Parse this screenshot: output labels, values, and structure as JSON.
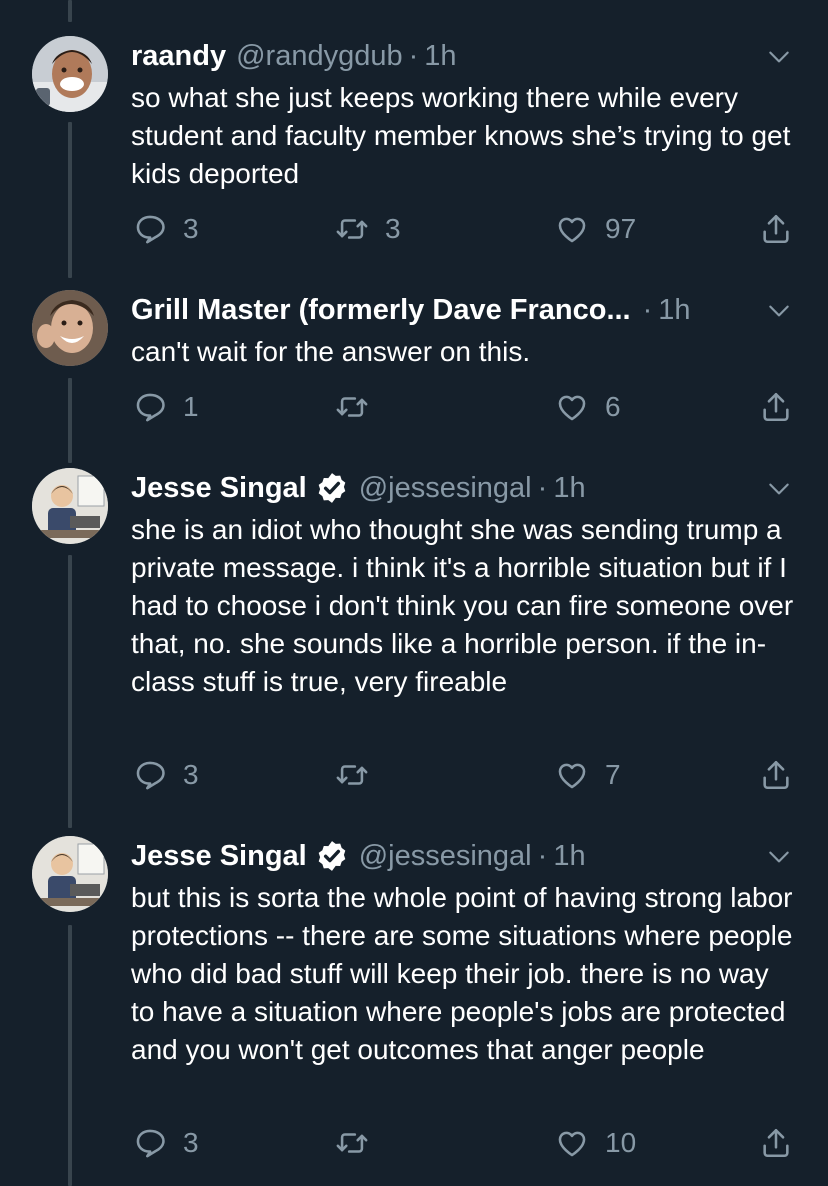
{
  "tweets": [
    {
      "name": "raandy",
      "handle": "@randygdub",
      "time": "1h",
      "verified": false,
      "text": "so what she just keeps working there while every student and faculty member knows she’s trying to get kids deported",
      "replies": "3",
      "retweets": "3",
      "likes": "97"
    },
    {
      "name": "Grill Master (formerly Dave Franco...",
      "handle": "",
      "time": "1h",
      "verified": false,
      "text": "can't wait for the answer on this.",
      "replies": "1",
      "retweets": "",
      "likes": "6"
    },
    {
      "name": "Jesse Singal",
      "handle": "@jessesingal",
      "time": "1h",
      "verified": true,
      "text": "she is an idiot who thought she was sending trump a private message. i think it's a horrible situation but if I had to choose i don't think you can fire someone over that, no. she sounds like a horrible person. if the in-class stuff is true, very fireable",
      "replies": "3",
      "retweets": "",
      "likes": "7"
    },
    {
      "name": "Jesse Singal",
      "handle": "@jessesingal",
      "time": "1h",
      "verified": true,
      "text": "but this is sorta the whole point of having strong labor protections -- there are some situations where people who did bad stuff will keep their job. there is no way to have a situation where people's jobs are protected and you won't get outcomes that anger people",
      "replies": "3",
      "retweets": "",
      "likes": "10"
    }
  ],
  "separator": "·",
  "colors": {
    "background": "#15202b",
    "text": "#ffffff",
    "secondary": "#8899a6",
    "thread_line": "#38444d",
    "verified": "#ffffff"
  },
  "icons": {
    "reply": "reply-icon",
    "retweet": "retweet-icon",
    "like": "heart-icon",
    "share": "share-icon",
    "more": "chevron-down-icon",
    "verified": "verified-badge-icon"
  }
}
